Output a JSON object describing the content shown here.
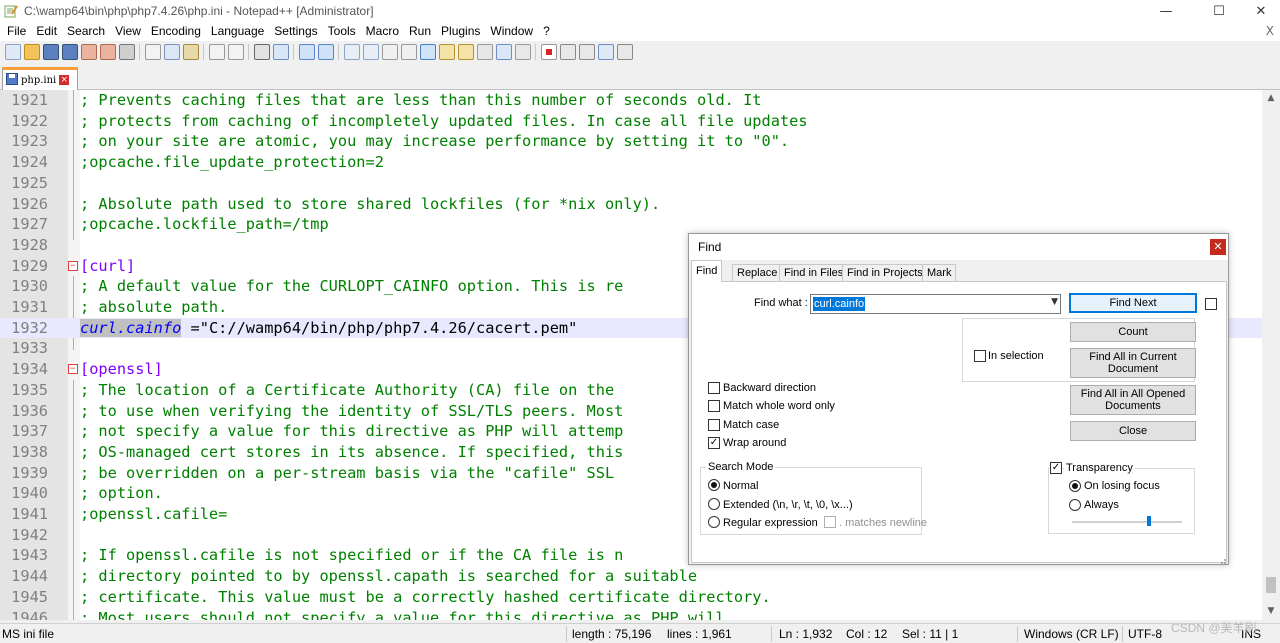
{
  "window": {
    "title": "C:\\wamp64\\bin\\php\\php7.4.26\\php.ini - Notepad++ [Administrator]",
    "minimize": "—",
    "maximize": "☐",
    "close": "✕"
  },
  "menu": {
    "items": [
      "File",
      "Edit",
      "Search",
      "View",
      "Encoding",
      "Language",
      "Settings",
      "Tools",
      "Macro",
      "Run",
      "Plugins",
      "Window",
      "?"
    ],
    "close_doc": "X"
  },
  "tab": {
    "label": "php.ini",
    "close": "×"
  },
  "editor": {
    "lines": [
      {
        "n": "1921",
        "text": "; Prevents caching files that are less than this number of seconds old. It",
        "kind": "comment"
      },
      {
        "n": "1922",
        "text": "; protects from caching of incompletely updated files. In case all file updates",
        "kind": "comment"
      },
      {
        "n": "1923",
        "text": "; on your site are atomic, you may increase performance by setting it to \"0\".",
        "kind": "comment"
      },
      {
        "n": "1924",
        "text": ";opcache.file_update_protection=2",
        "kind": "comment"
      },
      {
        "n": "1925",
        "text": "",
        "kind": "plain"
      },
      {
        "n": "1926",
        "text": "; Absolute path used to store shared lockfiles (for *nix only).",
        "kind": "comment"
      },
      {
        "n": "1927",
        "text": ";opcache.lockfile_path=/tmp",
        "kind": "comment"
      },
      {
        "n": "1928",
        "text": "",
        "kind": "plain"
      },
      {
        "n": "1929",
        "text": "[curl]",
        "kind": "section"
      },
      {
        "n": "1930",
        "text": "; A default value for the CURLOPT_CAINFO option. This is re",
        "kind": "comment"
      },
      {
        "n": "1931",
        "text": "; absolute path.",
        "kind": "comment"
      },
      {
        "n": "1932",
        "key": "curl.cainfo",
        "rest": " =\"C://wamp64/bin/php/php7.4.26/cacert.pem\"",
        "kind": "keyvalue"
      },
      {
        "n": "1933",
        "text": "",
        "kind": "plain"
      },
      {
        "n": "1934",
        "text": "[openssl]",
        "kind": "section"
      },
      {
        "n": "1935",
        "text": "; The location of a Certificate Authority (CA) file on the",
        "kind": "comment"
      },
      {
        "n": "1936",
        "text": "; to use when verifying the identity of SSL/TLS peers. Most",
        "kind": "comment"
      },
      {
        "n": "1937",
        "text": "; not specify a value for this directive as PHP will attemp",
        "kind": "comment"
      },
      {
        "n": "1938",
        "text": "; OS-managed cert stores in its absence. If specified, this",
        "kind": "comment"
      },
      {
        "n": "1939",
        "text": "; be overridden on a per-stream basis via the \"cafile\" SSL",
        "kind": "comment"
      },
      {
        "n": "1940",
        "text": "; option.",
        "kind": "comment"
      },
      {
        "n": "1941",
        "text": ";openssl.cafile=",
        "kind": "comment"
      },
      {
        "n": "1942",
        "text": "",
        "kind": "plain"
      },
      {
        "n": "1943",
        "text": "; If openssl.cafile is not specified or if the CA file is n",
        "kind": "comment"
      },
      {
        "n": "1944",
        "text": "; directory pointed to by openssl.capath is searched for a suitable",
        "kind": "comment"
      },
      {
        "n": "1945",
        "text": "; certificate. This value must be a correctly hashed certificate directory.",
        "kind": "comment"
      },
      {
        "n": "1946",
        "text": "; Most users should not specify a value for this directive as PHP will",
        "kind": "comment"
      }
    ]
  },
  "find": {
    "title": "Find",
    "tabs": [
      "Find",
      "Replace",
      "Find in Files",
      "Find in Projects",
      "Mark"
    ],
    "find_what_label": "Find what :",
    "find_what_value": "curl.cainfo",
    "buttons": {
      "find_next": "Find Next",
      "count": "Count",
      "find_all_current": "Find All in Current Document",
      "find_all_opened": "Find All in All Opened Documents",
      "close": "Close"
    },
    "in_selection": "In selection",
    "options": {
      "backward": "Backward direction",
      "whole_word": "Match whole word only",
      "match_case": "Match case",
      "wrap_around": "Wrap around"
    },
    "search_mode": {
      "title": "Search Mode",
      "normal": "Normal",
      "extended": "Extended (\\n, \\r, \\t, \\0, \\x...)",
      "regex": "Regular expression",
      "matches_newline": ". matches newline"
    },
    "transparency": {
      "label": "Transparency",
      "on_losing_focus": "On losing focus",
      "always": "Always"
    }
  },
  "status": {
    "file_type": "MS ini file",
    "length": "length : 75,196",
    "lines": "lines : 1,961",
    "ln": "Ln : 1,932",
    "col": "Col : 12",
    "sel": "Sel : 11 | 1",
    "eol": "Windows (CR LF)",
    "encoding": "UTF-8",
    "ins": "INS"
  },
  "watermark": "CSDN @美羊刷",
  "colors": {
    "comment": "#008000",
    "section": "#8000ff",
    "key": "#0000ff",
    "current_line": "#e8e8ff",
    "tab_accent": "#fa9d3a",
    "close_red": "#c42b1c"
  }
}
